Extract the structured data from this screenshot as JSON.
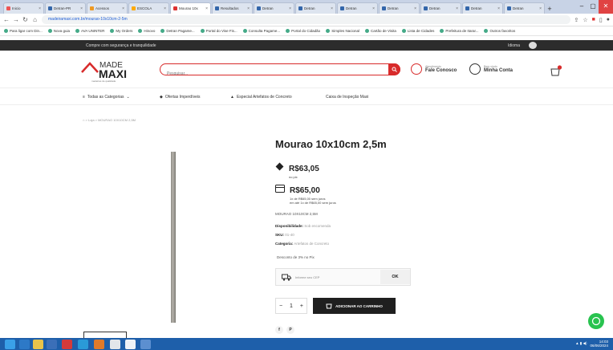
{
  "browser": {
    "tabs": [
      {
        "label": "Inicio",
        "color": "#e55"
      },
      {
        "label": "Detran-PR",
        "color": "#36a"
      },
      {
        "label": "Acessos",
        "color": "#e92"
      },
      {
        "label": "ESCOLA",
        "color": "#fa0"
      },
      {
        "label": "Mourao 10x",
        "color": "#d33",
        "active": true
      },
      {
        "label": "Resultados",
        "color": "#36a"
      },
      {
        "label": "Detran",
        "color": "#36a"
      },
      {
        "label": "Detran",
        "color": "#36a"
      },
      {
        "label": "Detran",
        "color": "#36a"
      },
      {
        "label": "Detran",
        "color": "#36a"
      },
      {
        "label": "Detran",
        "color": "#36a"
      },
      {
        "label": "Detran",
        "color": "#36a"
      },
      {
        "label": "Detran",
        "color": "#36a"
      }
    ],
    "url": "madeiramaxi.com.br/mourao-10x10cm-2-5m",
    "bookmarks": [
      "Para ligar com Din...",
      "Nova guia",
      "AVA UNINTER",
      "My Orders",
      "Hinovo",
      "Detran Pagame...",
      "Portal do Vise Fis...",
      "Consulta Pagame...",
      "Portal do Cidadão",
      "Simples Nacional",
      "Cartão de Visita",
      "Lista de Cidades",
      "Prefeitura de Itarar...",
      "Outros favoritos"
    ]
  },
  "promo": {
    "text": "Compre com segurança e tranquilidade",
    "lang": "Idioma"
  },
  "header": {
    "logo_made": "MADE",
    "logo_maxi": "MAXI",
    "logo_tagline": "madeiras de qualidade",
    "search_placeholder": "Pesquisar...",
    "contact_small": "Atendimento",
    "contact_label": "Fale Conosco",
    "account_small": "Bem-vindo",
    "account_label": "Minha Conta",
    "cart_count": "0"
  },
  "nav": {
    "all_categories": "Todas as Categorias",
    "offers": "Ofertas Imperdíveis",
    "special": "Especial Artefatos de Concreto",
    "inspection": "Caixa de Inspeção Maxi"
  },
  "breadcrumb": "⌂  >  Loja  >  MOURAO 10X10CM 2,5M",
  "product": {
    "title": "Mourao 10x10cm 2,5m",
    "pix_price": "R$63,05",
    "pix_label": "no pix",
    "card_price": "R$65,00",
    "installments_1": "1x de R$65,00 sem juros",
    "installments_2": "em até 1x de R$65,00 sem juros",
    "sku_text": "MOURAO 10X10CM 2,5M",
    "availability_label": "Disponibilidade:",
    "availability_value": "Sob encomenda",
    "sku_label": "SKU:",
    "sku_value": "01-40",
    "category_label": "Categoria:",
    "category_value": "Artefatos de Concreto",
    "discount_text": "Desconto de 3% no Pix",
    "shipping_placeholder": "Informe seu CEP",
    "shipping_ok": "OK",
    "quantity": "1",
    "add_to_cart": "ADICIONAR AO CARRINHO"
  },
  "taskbar": {
    "time": "14:03",
    "date": "06/06/2024"
  }
}
